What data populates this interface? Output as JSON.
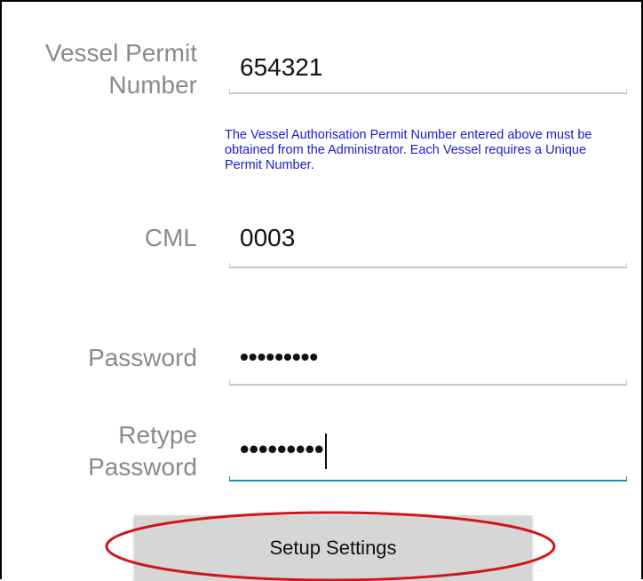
{
  "form": {
    "vessel_permit": {
      "label_line1": "Vessel Permit",
      "label_line2": "Number",
      "value": "654321"
    },
    "hint": "The Vessel Authorisation Permit Number entered above must be obtained from the Administrator. Each Vessel requires a Unique Permit Number.",
    "cml": {
      "label": "CML",
      "value": "0003"
    },
    "password": {
      "label": "Password",
      "masked_value": "•••••••••"
    },
    "retype_password": {
      "label_line1": "Retype",
      "label_line2": "Password",
      "masked_value": "•••••••••"
    }
  },
  "actions": {
    "setup_label": "Setup Settings"
  },
  "colors": {
    "label_gray": "#8a8a8a",
    "hint_blue": "#1a1ad0",
    "focus_underline": "#1f8fb3",
    "annotation_red": "#d0151b",
    "button_bg": "#d6d6d6"
  }
}
